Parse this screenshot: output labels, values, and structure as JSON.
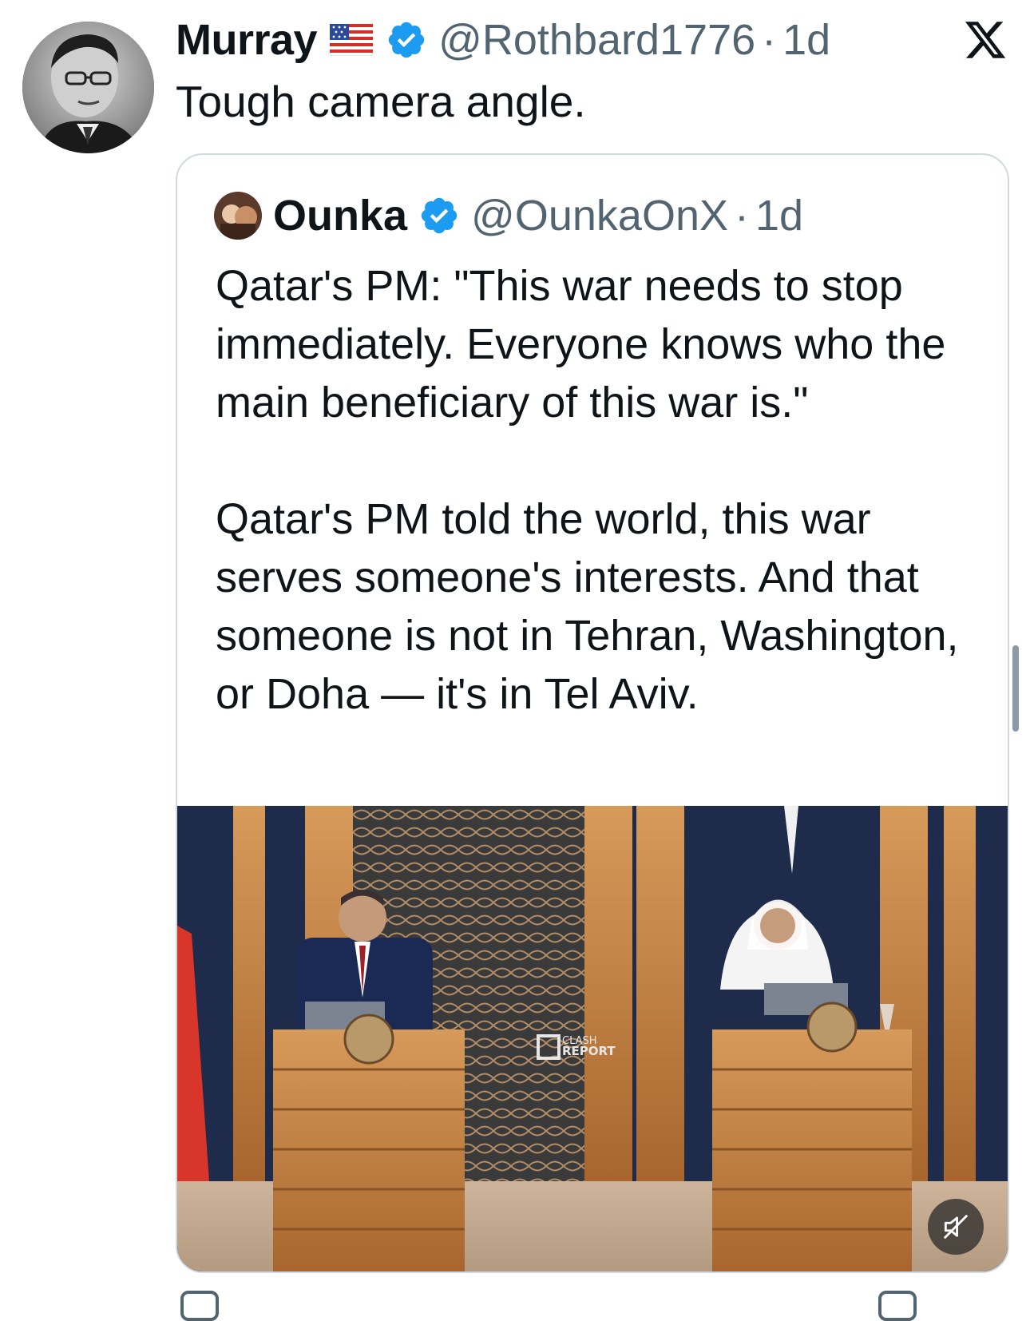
{
  "tweet": {
    "author": {
      "name": "Murray",
      "handle": "@Rothbard1776",
      "time": "1d",
      "flag_icon": "us-flag-icon",
      "verified_icon": "verified-badge-icon",
      "verified_color": "#1d9bf0"
    },
    "text": "Tough camera angle."
  },
  "quote": {
    "author": {
      "name": "Ounka",
      "handle": "@OunkaOnX",
      "time": "1d",
      "verified_icon": "verified-badge-icon"
    },
    "paragraphs": [
      "Qatar's PM: \"This war needs to stop immediately. Everyone knows who the main beneficiary of this war is.\"",
      "Qatar's PM told the world, this war serves someone's interests. And that someone is not in Tehran, Washington, or Doha — it's in Tel Aviv."
    ],
    "media": {
      "kind": "video",
      "watermark_top": "CLASH",
      "watermark_bottom": "REPORT",
      "mute_icon": "muted-speaker-icon"
    }
  },
  "app": {
    "logo_icon": "x-logo-icon"
  },
  "colors": {
    "text": "#0f1419",
    "secondary": "#536471",
    "border": "#cfd9de",
    "accent": "#1d9bf0"
  }
}
